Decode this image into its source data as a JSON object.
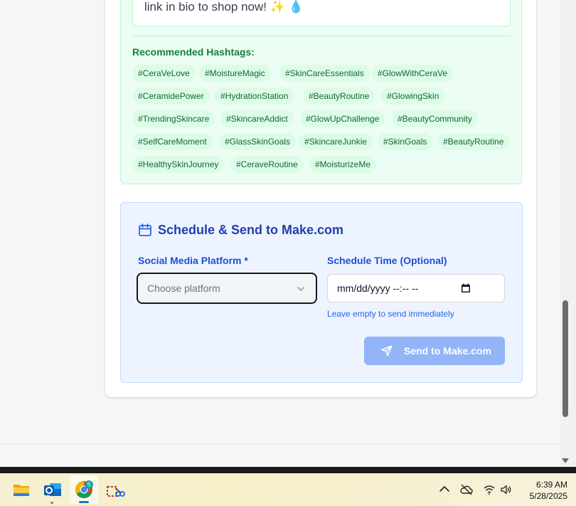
{
  "caption": {
    "text": "link in bio to shop now! ✨ 💧"
  },
  "hashtags": {
    "title": "Recommended Hashtags:",
    "tags": [
      "#CeraVeLove",
      "#MoistureMagic",
      "#SkinCareEssentials",
      "#GlowWithCeraVe",
      "#CeramidePower",
      "#HydrationStation",
      "#BeautyRoutine",
      "#GlowingSkin",
      "#TrendingSkincare",
      "#SkincareAddict",
      "#GlowUpChallenge",
      "#BeautyCommunity",
      "#SelfCareMoment",
      "#GlassSkinGoals",
      "#SkincareJunkie",
      "#SkinGoals",
      "#BeautyRoutine",
      "#HealthySkinJourney",
      "#CeraveRoutine",
      "#MoisturizeMe"
    ]
  },
  "schedule": {
    "title": "Schedule & Send to Make.com",
    "platform_label": "Social Media Platform *",
    "platform_placeholder": "Choose platform",
    "time_label": "Schedule Time (Optional)",
    "time_value": "mm/dd/yyyy --:-- --",
    "hint": "Leave empty to send immediately",
    "send_label": "Send to Make.com"
  },
  "taskbar": {
    "time": "6:39 AM",
    "date": "5/28/2025",
    "chrome_badge": "S"
  },
  "colors": {
    "accent": "#1e40af",
    "send_button": "#93b4f9",
    "tag_bg": "#dcfce7"
  }
}
